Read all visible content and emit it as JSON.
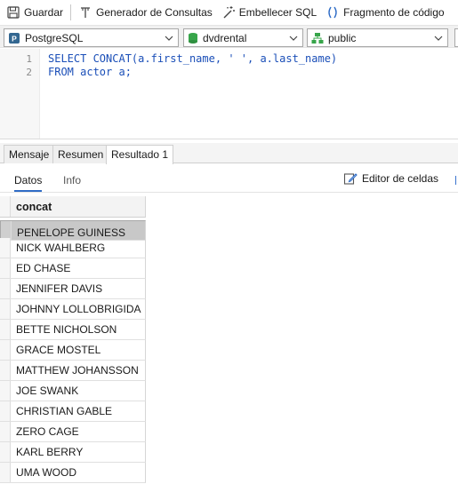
{
  "toolbar": {
    "save_label": "Guardar",
    "query_builder_label": "Generador de Consultas",
    "beautify_label": "Embellecer SQL",
    "snippet_label": "Fragmento de código"
  },
  "selectors": {
    "connection": "PostgreSQL",
    "database": "dvdrental",
    "schema": "public"
  },
  "editor": {
    "lines": [
      {
        "num": "1",
        "tokens": [
          {
            "t": "SELECT",
            "c": "kw"
          },
          {
            "t": " CONCAT(a.first_name, ",
            "c": "plain"
          },
          {
            "t": "' '",
            "c": "str"
          },
          {
            "t": ", a.last_name)",
            "c": "plain"
          }
        ]
      },
      {
        "num": "2",
        "tokens": [
          {
            "t": "FROM",
            "c": "kw"
          },
          {
            "t": " actor a;",
            "c": "plain"
          }
        ]
      }
    ]
  },
  "result_tabs": [
    "Mensaje",
    "Resumen",
    "Resultado 1"
  ],
  "active_result_tab": "Resultado 1",
  "subtabs": {
    "data": "Datos",
    "info": "Info",
    "cell_editor": "Editor de celdas"
  },
  "grid": {
    "column": "concat",
    "selected_row": 0,
    "rows": [
      "PENELOPE GUINESS",
      "NICK WAHLBERG",
      "ED CHASE",
      "JENNIFER DAVIS",
      "JOHNNY LOLLOBRIGIDA",
      "BETTE NICHOLSON",
      "GRACE MOSTEL",
      "MATTHEW JOHANSSON",
      "JOE SWANK",
      "CHRISTIAN GABLE",
      "ZERO CAGE",
      "KARL BERRY",
      "UMA WOOD"
    ]
  },
  "colors": {
    "keyword": "#1b4fb8",
    "accent": "#2f6cc6",
    "selected_row": "#c8c8c8"
  }
}
